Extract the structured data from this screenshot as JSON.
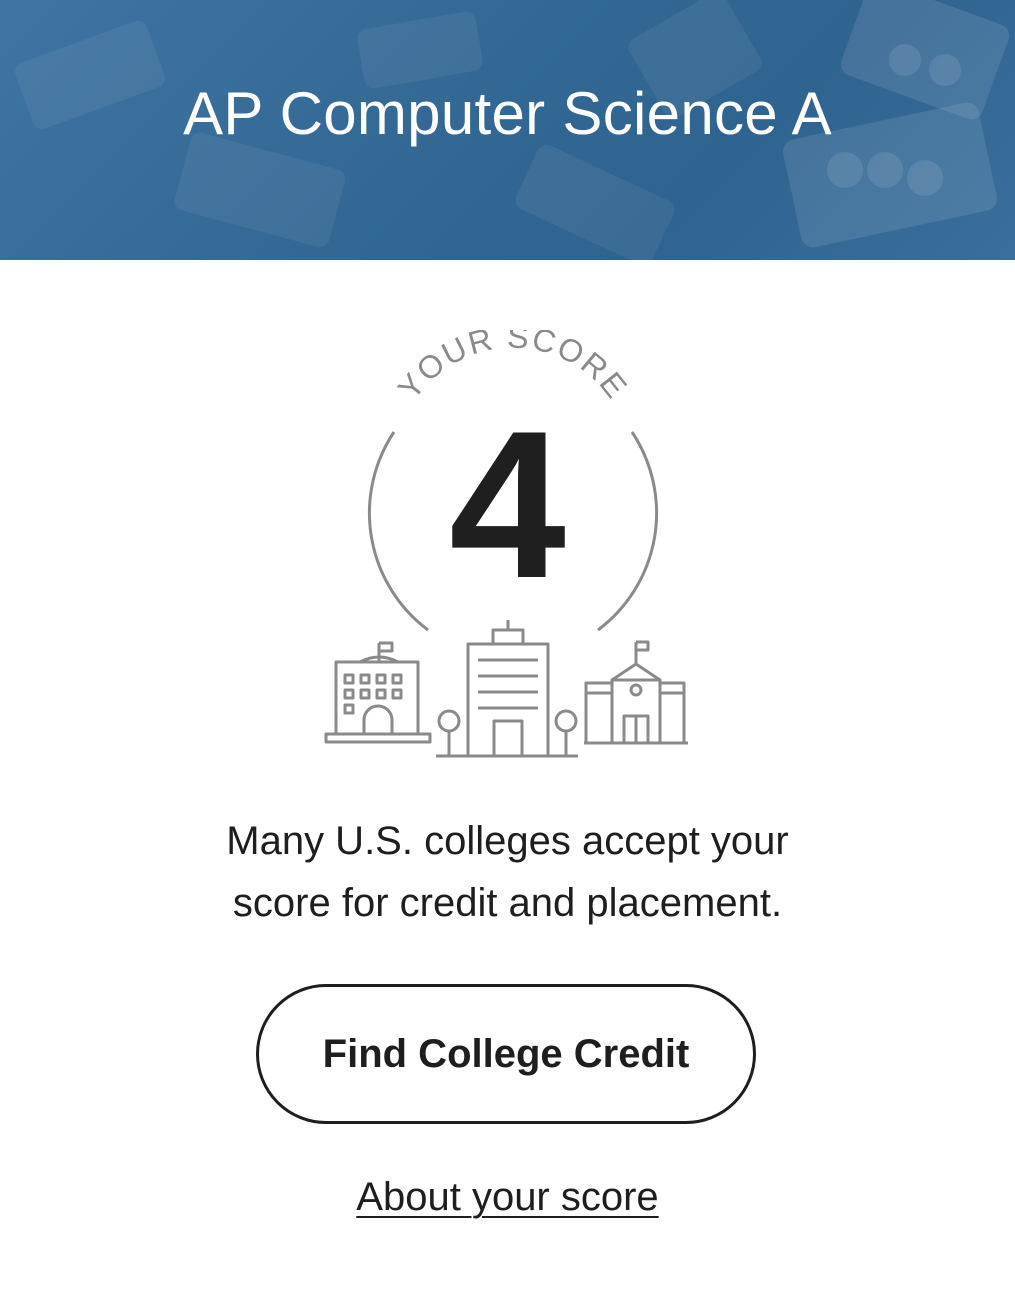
{
  "header": {
    "title": "AP Computer Science A",
    "background_color": "#336894"
  },
  "score": {
    "label": "YOUR SCORE",
    "value": "4",
    "illustration_icon": "college-buildings-icon"
  },
  "message": {
    "line1": "Many U.S. colleges accept your",
    "line2": "score for credit and placement."
  },
  "actions": {
    "primary_button_label": "Find College Credit",
    "secondary_link_label": "About your score"
  },
  "colors": {
    "text": "#1e1e1e",
    "illustration_stroke": "#8a8a8a"
  }
}
